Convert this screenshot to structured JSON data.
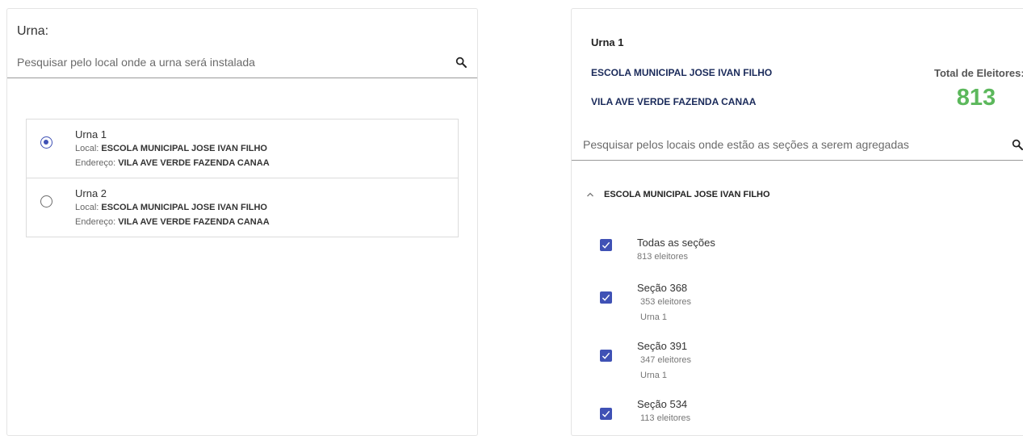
{
  "left": {
    "title": "Urna:",
    "search_placeholder": "Pesquisar pelo local onde a urna será instalada",
    "urnas": [
      {
        "name": "Urna 1",
        "local_label": "Local:",
        "local": "ESCOLA MUNICIPAL JOSE IVAN FILHO",
        "endereco_label": "Endereço:",
        "endereco": "VILA AVE VERDE FAZENDA CANAA",
        "selected": true
      },
      {
        "name": "Urna 2",
        "local_label": "Local:",
        "local": "ESCOLA MUNICIPAL JOSE IVAN FILHO",
        "endereco_label": "Endereço:",
        "endereco": "VILA AVE VERDE FAZENDA CANAA",
        "selected": false
      }
    ]
  },
  "right": {
    "urna": "Urna 1",
    "local": "ESCOLA MUNICIPAL JOSE IVAN FILHO",
    "endereco": "VILA AVE VERDE FAZENDA CANAA",
    "total_label": "Total de Eleitores:",
    "total_value": "813",
    "search_placeholder": "Pesquisar pelos locais onde estão as seções a serem agregadas",
    "group": {
      "title": "ESCOLA MUNICIPAL JOSE IVAN FILHO",
      "all": {
        "label": "Todas as seções",
        "eleitores": "813 eleitores",
        "checked": true
      },
      "sections": [
        {
          "name": "Seção 368",
          "eleitores": "353 eleitores",
          "urna": "Urna 1",
          "checked": true
        },
        {
          "name": "Seção 391",
          "eleitores": "347 eleitores",
          "urna": "Urna 1",
          "checked": true
        },
        {
          "name": "Seção 534",
          "eleitores": "113 eleitores",
          "urna": "",
          "checked": true
        }
      ]
    }
  },
  "colors": {
    "accent": "#3f51b5",
    "total_green": "#5cb85c",
    "dark_navy": "#1a2a5a"
  }
}
